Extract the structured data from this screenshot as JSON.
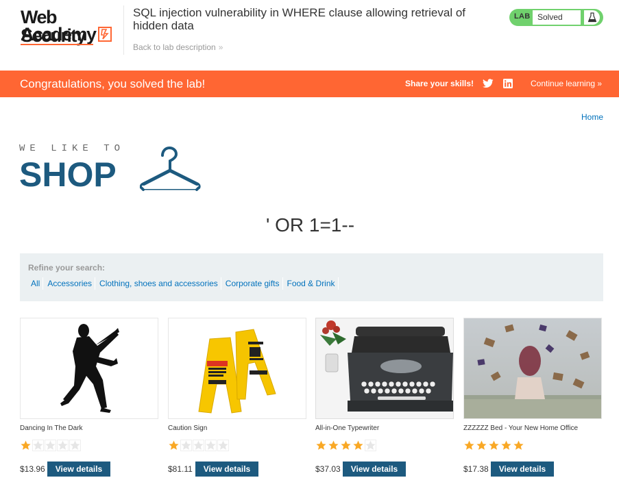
{
  "header": {
    "logo_line1": "Web Security",
    "logo_line2": "Academy",
    "lab_title": "SQL injection vulnerability in WHERE clause allowing retrieval of hidden data",
    "back_link": "Back to lab description",
    "lab_tag": "LAB",
    "lab_status": "Solved"
  },
  "banner": {
    "message": "Congratulations, you solved the lab!",
    "share": "Share your skills!",
    "continue": "Continue learning"
  },
  "nav": {
    "home": "Home"
  },
  "shop_logo": {
    "tagline": "WE LIKE TO",
    "word": "SHOP"
  },
  "search_heading": "' OR 1=1--",
  "refine": {
    "label": "Refine your search:",
    "filters": [
      "All",
      "Accessories",
      "Clothing, shoes and accessories",
      "Corporate gifts",
      "Food & Drink"
    ]
  },
  "products": [
    {
      "name": "Dancing In The Dark",
      "rating": 1,
      "price": "$13.96",
      "button": "View details",
      "image": "dancing-silhouette"
    },
    {
      "name": "Caution Sign",
      "rating": 1,
      "price": "$81.11",
      "button": "View details",
      "image": "caution-signs"
    },
    {
      "name": "All-in-One Typewriter",
      "rating": 4,
      "price": "$37.03",
      "button": "View details",
      "image": "typewriter"
    },
    {
      "name": "ZZZZZZ Bed - Your New Home Office",
      "rating": 5,
      "price": "$17.38",
      "button": "View details",
      "image": "bed-books"
    }
  ],
  "colors": {
    "accent": "#ff6633",
    "brand_blue": "#1d5a7f",
    "link": "#0071bc",
    "solved_green": "#70d16d",
    "star": "#f9a825"
  }
}
